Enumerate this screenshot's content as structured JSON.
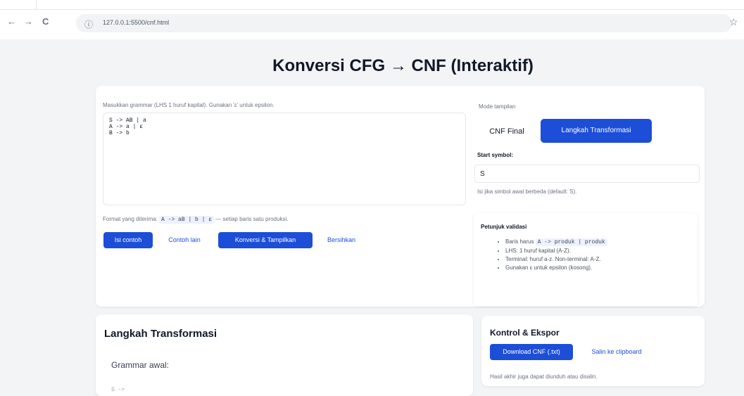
{
  "browser": {
    "url": "127.0.0.1:5500/cnf.html",
    "back_glyph": "←",
    "forward_glyph": "→",
    "reload_glyph": "C",
    "info_glyph": "ⓘ",
    "star_glyph": "☆"
  },
  "page": {
    "title": "Konversi CFG → CNF (Interaktif)"
  },
  "input": {
    "label": "Masukkan grammar (LHS 1 huruf kapital). Gunakan 'ε' untuk epsilon.",
    "grammar_text": "S -> AB | a\nA -> a | ε\nB -> b",
    "format_prefix": "Format yang diterima:",
    "format_code": "A -> aB | b | ε",
    "format_suffix": "— setiap baris satu produksi."
  },
  "actions": {
    "fill_example": "Isi contoh",
    "other_example": "Contoh lain",
    "convert": "Konversi & Tampilkan",
    "clear": "Bersihkan"
  },
  "view_mode": {
    "label": "Mode tampilan",
    "options": [
      "CNF Final",
      "Langkah Transformasi"
    ],
    "selected": "Langkah Transformasi"
  },
  "start_symbol": {
    "label": "Start symbol:",
    "value": "S",
    "help": "Isi jika simbol awal berbeda (default: S)."
  },
  "validation": {
    "title": "Petunjuk validasi",
    "items": [
      {
        "prefix": "Baris harus",
        "code": "A -> produk | produk"
      },
      {
        "text": "LHS: 1 huruf kapital (A-Z)."
      },
      {
        "text": "Terminal: huruf a-z. Non-terminal: A-Z."
      },
      {
        "text": "Gunakan ε untuk epsilon (kosong)."
      }
    ]
  },
  "steps": {
    "title": "Langkah Transformasi",
    "subtitle": "Grammar awal:",
    "code_preview": "S ->"
  },
  "export": {
    "title": "Kontrol & Ekspor",
    "download": "Download CNF (.txt)",
    "copy": "Salin ke clipboard",
    "note": "Hasil akhir juga dapat diunduh atau disalin."
  },
  "colors": {
    "primary": "#1d4ed8",
    "background": "#f3f4f6",
    "card": "#ffffff"
  }
}
